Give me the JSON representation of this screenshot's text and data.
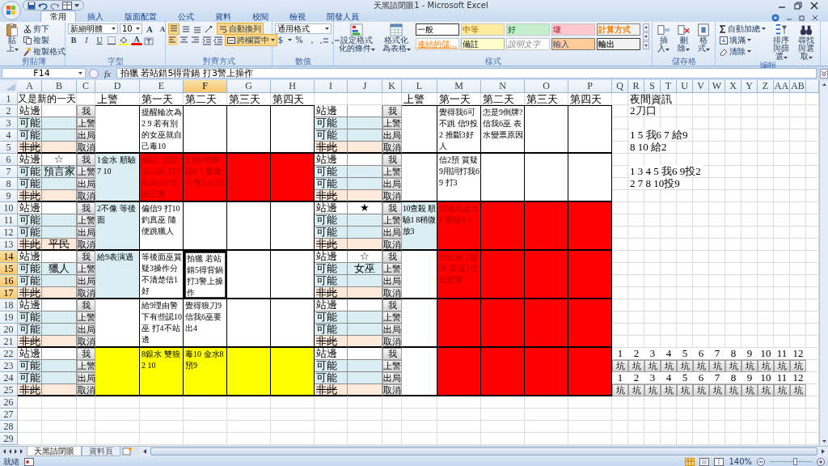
{
  "window": {
    "title": "天黑請閉眼1 - Microsoft Excel"
  },
  "ribbon": {
    "tabs": [
      {
        "label": "常用",
        "selected": true
      },
      {
        "label": "插入",
        "selected": false
      },
      {
        "label": "版面配置",
        "selected": false
      },
      {
        "label": "公式",
        "selected": false
      },
      {
        "label": "資料",
        "selected": false
      },
      {
        "label": "校閱",
        "selected": false
      },
      {
        "label": "檢視",
        "selected": false
      },
      {
        "label": "開發人員",
        "selected": false
      }
    ],
    "clipboard": {
      "paste": "貼上",
      "cut": "剪下",
      "copy": "複製",
      "format_painter": "複製格式",
      "label": "剪貼簿"
    },
    "font": {
      "name": "新細明體",
      "size": "10",
      "grow": "A",
      "shrink": "A",
      "bold": "B",
      "italic": "I",
      "underline": "U",
      "font_color": "A",
      "label": "字型"
    },
    "alignment": {
      "vertical_align": [
        {
          "selected": true
        },
        {
          "selected": false
        },
        {
          "selected": false
        }
      ],
      "horizontal_align": [
        {
          "selected": true
        },
        {
          "selected": false
        },
        {
          "selected": false
        }
      ],
      "wrap_text": {
        "label": "自動換列",
        "on": true
      },
      "merge_center": {
        "label": "跨欄置中",
        "on": true
      },
      "label": "對齊方式"
    },
    "number": {
      "format": "通用格式",
      "currency": "$",
      "percent": "%",
      "comma": ",",
      "label": "數值"
    },
    "styles": {
      "conditional": "設定格式化的條件",
      "as_table": "格式化為表格",
      "gallery": [
        {
          "label": "一般",
          "kind": "normal"
        },
        {
          "label": "中等",
          "kind": "neutral"
        },
        {
          "label": "好",
          "kind": "good"
        },
        {
          "label": "壞",
          "kind": "bad"
        },
        {
          "label": "計算方式",
          "kind": "calc"
        },
        {
          "label": "連結的儲...",
          "kind": "linked"
        },
        {
          "label": "備註",
          "kind": "note"
        },
        {
          "label": "說明文字",
          "kind": "explanatory"
        },
        {
          "label": "輸入",
          "kind": "input"
        },
        {
          "label": "輸出",
          "kind": "output"
        }
      ],
      "label": "樣式"
    },
    "cells": {
      "insert": "插入",
      "delete": "刪除",
      "format": "格式",
      "label": "儲存格"
    },
    "editing": {
      "autosum": "自動加總",
      "fill": "填滿",
      "clear": "清除",
      "sort": "排序與篩選",
      "find": "尋找與選取",
      "label": "編輯"
    }
  },
  "formula_bar": {
    "name_box": "F14",
    "fx": "fx",
    "formula": "拍獵 若站錯5得背鍋 打3警上操作"
  },
  "sheet": {
    "columns": [
      {
        "label": "A",
        "selected": false
      },
      {
        "label": "B",
        "selected": false
      },
      {
        "label": "C",
        "selected": false
      },
      {
        "label": "D",
        "selected": false
      },
      {
        "label": "E",
        "selected": false
      },
      {
        "label": "F",
        "selected": true
      },
      {
        "label": "G",
        "selected": false
      },
      {
        "label": "H",
        "selected": false
      },
      {
        "label": "I",
        "selected": false
      },
      {
        "label": "J",
        "selected": false
      },
      {
        "label": "K",
        "selected": false
      },
      {
        "label": "L",
        "selected": false
      },
      {
        "label": "M",
        "selected": false
      },
      {
        "label": "N",
        "selected": false
      },
      {
        "label": "O",
        "selected": false
      },
      {
        "label": "P",
        "selected": false
      },
      {
        "label": "Q",
        "selected": false
      },
      {
        "label": "R",
        "selected": false
      },
      {
        "label": "S",
        "selected": false
      },
      {
        "label": "T",
        "selected": false
      },
      {
        "label": "U",
        "selected": false
      },
      {
        "label": "V",
        "selected": false
      },
      {
        "label": "W",
        "selected": false
      },
      {
        "label": "X",
        "selected": false
      },
      {
        "label": "Y",
        "selected": false
      },
      {
        "label": "Z",
        "selected": false
      },
      {
        "label": "AA",
        "selected": false
      },
      {
        "label": "AB",
        "selected": false
      }
    ],
    "rows": [
      {
        "label": "1",
        "selected": false
      },
      {
        "label": "2",
        "selected": false
      },
      {
        "label": "3",
        "selected": false
      },
      {
        "label": "4",
        "selected": false
      },
      {
        "label": "5",
        "selected": false
      },
      {
        "label": "6",
        "selected": false
      },
      {
        "label": "7",
        "selected": false
      },
      {
        "label": "8",
        "selected": false
      },
      {
        "label": "9",
        "selected": false
      },
      {
        "label": "10",
        "selected": false
      },
      {
        "label": "11",
        "selected": false
      },
      {
        "label": "12",
        "selected": false
      },
      {
        "label": "13",
        "selected": false
      },
      {
        "label": "14",
        "selected": true
      },
      {
        "label": "15",
        "selected": true
      },
      {
        "label": "16",
        "selected": true
      },
      {
        "label": "17",
        "selected": true
      },
      {
        "label": "18",
        "selected": false
      },
      {
        "label": "19",
        "selected": false
      },
      {
        "label": "20",
        "selected": false
      },
      {
        "label": "21",
        "selected": false
      },
      {
        "label": "22",
        "selected": false
      },
      {
        "label": "23",
        "selected": false
      },
      {
        "label": "24",
        "selected": false
      },
      {
        "label": "25",
        "selected": false
      },
      {
        "label": "26",
        "selected": false
      },
      {
        "label": "27",
        "selected": false
      },
      {
        "label": "28",
        "selected": false
      },
      {
        "label": "29",
        "selected": false
      }
    ],
    "title_cell": "又是新的一天",
    "day_headers_left": [
      "上警",
      "第一天",
      "第二天",
      "第三天",
      "第四天"
    ],
    "day_headers_right": [
      "上警",
      "第一天",
      "第二天",
      "第三天",
      "第四天"
    ],
    "left_blocks": [
      {
        "rows": [
          {
            "kind": "side",
            "label": "站邊"
          },
          {
            "kind": "maybe",
            "label": "可能"
          },
          {
            "kind": "maybe",
            "label": "可能"
          },
          {
            "kind": "not",
            "label": "非此"
          }
        ],
        "buttons": [
          "我",
          "上警",
          "出局",
          "取消"
        ],
        "notes": [
          {
            "color": "#ffffff",
            "selected": false
          },
          {
            "text": "提醒輪次為2 9 若有別的女巫就自己毒10",
            "color": "#ffffff",
            "selected": false
          },
          {
            "color": "#ffffff",
            "selected": false
          },
          {
            "color": "#ffffff",
            "selected": false
          },
          {
            "color": "#ffffff",
            "selected": false
          }
        ]
      },
      {
        "rows": [
          {
            "kind": "side",
            "label": "站邊",
            "role": "☆"
          },
          {
            "kind": "maybe",
            "label": "可能",
            "role": "預言家"
          },
          {
            "kind": "maybe",
            "label": "可能"
          },
          {
            "kind": "not",
            "label": "非此"
          }
        ],
        "buttons": [
          "我",
          "上警",
          "出局",
          "取消"
        ],
        "notes": [
          {
            "text": "1金水 順驗7 10",
            "color": "#daeef3",
            "selected": false
          },
          {
            "text": "喊話1回頭認10巫 打3認為567出第三隻",
            "color": "#ff0000",
            "selected": false
          },
          {
            "text": "9 我6雙狼認8 7 最後一隻3 4 5出",
            "color": "#ff0000",
            "selected": false
          },
          {
            "color": "#ff0000",
            "selected": false
          },
          {
            "color": "#ff0000",
            "selected": false
          }
        ]
      },
      {
        "rows": [
          {
            "kind": "side",
            "label": "站邊"
          },
          {
            "kind": "maybe",
            "label": "可能"
          },
          {
            "kind": "maybe",
            "label": "可能"
          },
          {
            "kind": "not",
            "label": "非此",
            "role": "平民"
          }
        ],
        "buttons": [
          "我",
          "上警",
          "出局",
          "取消"
        ],
        "notes": [
          {
            "text": "2不像 等後面",
            "color": "#daeef3",
            "selected": false
          },
          {
            "text": "偏信9 打10釣真巫 隨便跳獵人",
            "color": "#ffffff",
            "selected": false
          },
          {
            "color": "#ffffff",
            "selected": false
          },
          {
            "color": "#ffffff",
            "selected": false
          },
          {
            "color": "#ffffff",
            "selected": false
          }
        ]
      },
      {
        "rows": [
          {
            "kind": "side",
            "label": "站邊"
          },
          {
            "kind": "maybe",
            "label": "可能",
            "role": "獵人"
          },
          {
            "kind": "maybe",
            "label": "可能"
          },
          {
            "kind": "not",
            "label": "非此"
          }
        ],
        "buttons": [
          "我",
          "上警",
          "出局",
          "取消"
        ],
        "notes": [
          {
            "text": "給9表演過",
            "color": "#daeef3",
            "selected": false
          },
          {
            "text": "等後面巫質疑3操作分不清楚信1好",
            "color": "#ffffff",
            "selected": false
          },
          {
            "text": "拍獵 若站錯5得背鍋打3警上操作",
            "color": "#ffffff",
            "selected": true
          },
          {
            "color": "#ffffff",
            "selected": false
          },
          {
            "color": "#ffffff",
            "selected": false
          }
        ]
      },
      {
        "rows": [
          {
            "kind": "side",
            "label": "站邊"
          },
          {
            "kind": "maybe",
            "label": "可能"
          },
          {
            "kind": "maybe",
            "label": "可能"
          },
          {
            "kind": "not",
            "label": "非此"
          }
        ],
        "buttons": [
          "我",
          "上警",
          "出局",
          "取消"
        ],
        "notes": [
          {
            "color": "#ffffff",
            "selected": false
          },
          {
            "text": "給9理由警下有些認10巫 打4不站邊",
            "color": "#ffffff",
            "selected": false
          },
          {
            "text": "覺得狼刀9信我6巫要出4",
            "color": "#ffffff",
            "selected": false
          },
          {
            "color": "#ffffff",
            "selected": false
          },
          {
            "color": "#ffffff",
            "selected": false
          }
        ]
      },
      {
        "rows": [
          {
            "kind": "side",
            "label": "站邊"
          },
          {
            "kind": "maybe",
            "label": "可能"
          },
          {
            "kind": "maybe",
            "label": "可能"
          },
          {
            "kind": "not",
            "label": "非此"
          }
        ],
        "buttons": [
          "我",
          "上警",
          "出局",
          "取消"
        ],
        "notes": [
          {
            "color": "#ffff00",
            "selected": false
          },
          {
            "text": "8銀水 雙狼2 10",
            "color": "#ffff00",
            "selected": false
          },
          {
            "text": "毒10 金水8預9",
            "color": "#ffff00",
            "selected": false
          },
          {
            "color": "#ffff00",
            "selected": false
          },
          {
            "color": "#ffff00",
            "selected": false
          }
        ]
      }
    ],
    "right_blocks": [
      {
        "rows": [
          {
            "kind": "side",
            "label": "站邊"
          },
          {
            "kind": "maybe",
            "label": "可能"
          },
          {
            "kind": "maybe",
            "label": "可能"
          },
          {
            "kind": "not",
            "label": "非此"
          }
        ],
        "buttons": [
          "我",
          "上警",
          "出局",
          "取消"
        ],
        "notes": [
          {
            "color": "#ffffff",
            "selected": false
          },
          {
            "text": "覺得我6可不跳 信9投2 推斷3好人",
            "color": "#ffffff",
            "selected": false
          },
          {
            "text": "怎是9倒牌?信我6巫 表水變票原因",
            "color": "#ffffff",
            "selected": false
          },
          {
            "color": "#ffffff",
            "selected": false
          },
          {
            "color": "#ffffff",
            "selected": false
          }
        ]
      },
      {
        "rows": [
          {
            "kind": "side",
            "label": "站邊"
          },
          {
            "kind": "maybe",
            "label": "可能"
          },
          {
            "kind": "maybe",
            "label": "可能"
          },
          {
            "kind": "not",
            "label": "非此"
          }
        ],
        "buttons": [
          "我",
          "上警",
          "出局",
          "取消"
        ],
        "notes": [
          {
            "color": "#ffffff",
            "selected": false
          },
          {
            "text": "信2預 質疑9用詞打我6 9 打3",
            "color": "#ffffff",
            "selected": false
          },
          {
            "color": "#ffffff",
            "selected": false
          },
          {
            "color": "#ffffff",
            "selected": false
          },
          {
            "color": "#ffffff",
            "selected": false
          }
        ]
      },
      {
        "rows": [
          {
            "kind": "side",
            "label": "站邊",
            "role": "★"
          },
          {
            "kind": "maybe",
            "label": "可能"
          },
          {
            "kind": "maybe",
            "label": "可能"
          },
          {
            "kind": "not",
            "label": "非此"
          }
        ],
        "buttons": [
          "我",
          "上警",
          "出局",
          "取消"
        ],
        "notes": [
          {
            "text": "10查殺 順驗1 8稍微放3",
            "color": "#daeef3",
            "selected": false
          },
          {
            "text": "怕獵民故出2 順驗8 4",
            "color": "#ff0000",
            "selected": false
          },
          {
            "color": "#ff0000",
            "selected": false
          },
          {
            "color": "#ff0000",
            "selected": false
          },
          {
            "color": "#ff0000",
            "selected": false
          }
        ]
      },
      {
        "rows": [
          {
            "kind": "side",
            "label": "站邊",
            "role": "☆"
          },
          {
            "kind": "maybe",
            "label": "可能",
            "role": "女巫"
          },
          {
            "kind": "maybe",
            "label": "可能"
          },
          {
            "kind": "not",
            "label": "非此"
          }
        ],
        "buttons": [
          "我",
          "上警",
          "出局",
          "取消"
        ],
        "notes": [
          {
            "color": "#ffffff",
            "selected": false
          },
          {
            "text": "拍女巫 2銀水 質疑3拉低預面",
            "color": "#ff0000",
            "selected": false
          },
          {
            "color": "#ff0000",
            "selected": false
          },
          {
            "color": "#ff0000",
            "selected": false
          },
          {
            "color": "#ff0000",
            "selected": false
          }
        ]
      },
      {
        "rows": [
          {
            "kind": "side",
            "label": "站邊"
          },
          {
            "kind": "maybe",
            "label": "可能"
          },
          {
            "kind": "maybe",
            "label": "可能"
          },
          {
            "kind": "not",
            "label": "非此"
          }
        ],
        "buttons": [
          "我",
          "上警",
          "出局",
          "取消"
        ],
        "notes": [
          {
            "color": "#ffffff",
            "selected": false
          },
          {
            "color": "#ff0000",
            "selected": false
          },
          {
            "color": "#ff0000",
            "selected": false
          },
          {
            "color": "#ff0000",
            "selected": false
          },
          {
            "color": "#ff0000",
            "selected": false
          }
        ]
      },
      {
        "rows": [
          {
            "kind": "side",
            "label": "站邊"
          },
          {
            "kind": "maybe",
            "label": "可能"
          },
          {
            "kind": "maybe",
            "label": "可能"
          },
          {
            "kind": "not",
            "label": "非此"
          }
        ],
        "buttons": [
          "我",
          "上警",
          "出局",
          "取消"
        ],
        "notes": [
          {
            "color": "#ffffff",
            "selected": false
          },
          {
            "color": "#ff0000",
            "selected": false
          },
          {
            "color": "#ff0000",
            "selected": false
          },
          {
            "color": "#ff0000",
            "selected": false
          },
          {
            "color": "#ff0000",
            "selected": false
          }
        ]
      }
    ],
    "night_info": {
      "title": "夜間資訊",
      "groups": [
        [
          "2刀口"
        ],
        [
          "1 5 我6 7 給9",
          "8 10 給2"
        ],
        [
          "1 3 4 5 我6 9投2",
          "2 7 8 10投9"
        ]
      ]
    },
    "pits": [
      {
        "numbers": [
          "1",
          "2",
          "3",
          "4",
          "5",
          "6",
          "7",
          "8",
          "9",
          "10",
          "11",
          "12"
        ],
        "buttons": [
          "坑",
          "坑",
          "坑",
          "坑",
          "坑",
          "坑",
          "坑",
          "坑",
          "坑",
          "坑",
          "坑",
          "坑"
        ]
      },
      {
        "numbers": [
          "1",
          "2",
          "3",
          "4",
          "5",
          "6",
          "7",
          "8",
          "9",
          "10",
          "11",
          "12"
        ],
        "buttons": [
          "坑",
          "坑",
          "坑",
          "坑",
          "坑",
          "坑",
          "坑",
          "坑",
          "坑",
          "坑",
          "坑",
          "坑"
        ]
      }
    ]
  },
  "sheet_tabs": [
    {
      "label": "天黑請閉眼",
      "selected": true
    },
    {
      "label": "資料頁",
      "selected": false
    }
  ],
  "status_bar": {
    "state": "就緒",
    "zoom": "140%",
    "zoom_slider": {
      "level": 0.6
    }
  }
}
